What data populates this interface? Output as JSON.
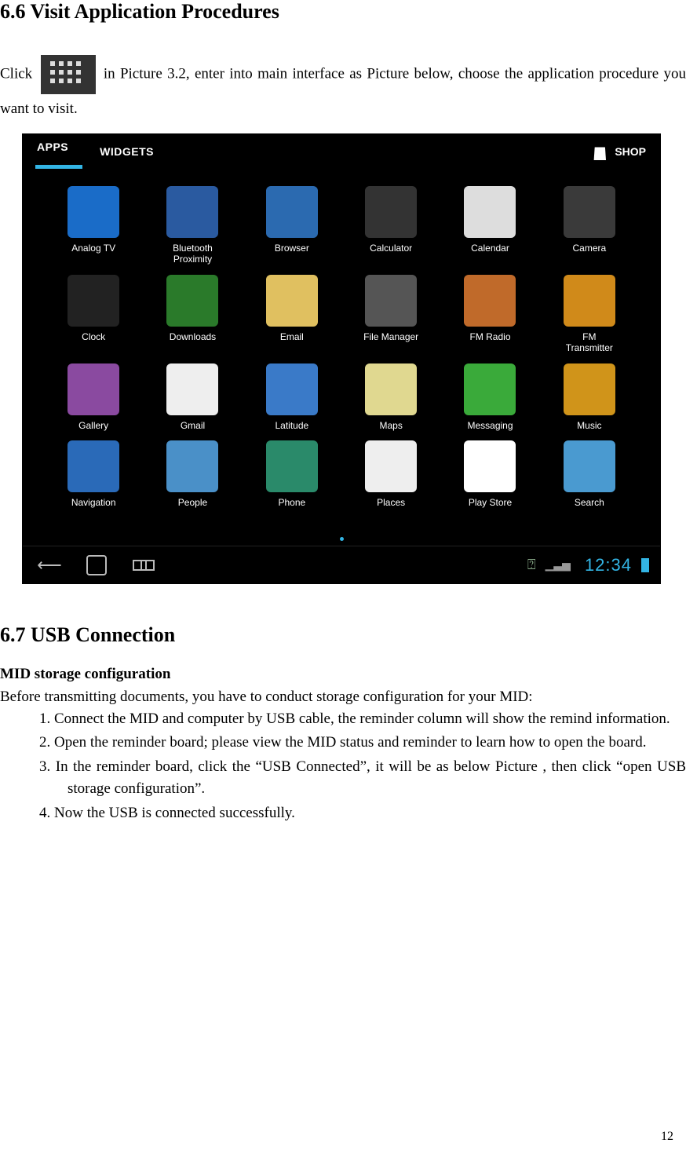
{
  "sections": {
    "s66": {
      "heading": "6.6 Visit Application Procedures",
      "para_a": "Click ",
      "para_b": "in  Picture  3.2,  enter  into  main  interface  as  Picture  below,  choose  the application procedure you want to visit."
    },
    "s67": {
      "heading": "6.7 USB Connection",
      "sub": "MID storage configuration",
      "intro": "Before transmitting documents, you have to conduct storage configuration for your MID:",
      "steps": [
        "1.  Connect the MID and computer by USB cable, the reminder column will show the remind information.",
        "2.   Open the reminder board; please view the MID status and reminder to learn how to open the board.",
        "3.   In  the  reminder  board,  click  the  “USB  Connected”,  it  will  be  as  below  Picture  ,  then click “open USB storage configuration”.",
        "4.   Now the USB is connected successfully."
      ]
    }
  },
  "screenshot": {
    "tabs": {
      "apps": "APPS",
      "widgets": "WIDGETS",
      "shop": "SHOP"
    },
    "apps": [
      {
        "label": "Analog TV",
        "bg": "#1a6cc8"
      },
      {
        "label": "Bluetooth\nProximity",
        "bg": "#2a5aa0"
      },
      {
        "label": "Browser",
        "bg": "#2b6ab0"
      },
      {
        "label": "Calculator",
        "bg": "#333"
      },
      {
        "label": "Calendar",
        "bg": "#ddd"
      },
      {
        "label": "Camera",
        "bg": "#3a3a3a"
      },
      {
        "label": "Clock",
        "bg": "#222"
      },
      {
        "label": "Downloads",
        "bg": "#2a7a2a"
      },
      {
        "label": "Email",
        "bg": "#e0c060"
      },
      {
        "label": "File Manager",
        "bg": "#555"
      },
      {
        "label": "FM Radio",
        "bg": "#c06a2a"
      },
      {
        "label": "FM\nTransmitter",
        "bg": "#d08a1a"
      },
      {
        "label": "Gallery",
        "bg": "#8a4aa0"
      },
      {
        "label": "Gmail",
        "bg": "#eee"
      },
      {
        "label": "Latitude",
        "bg": "#3a7ac8"
      },
      {
        "label": "Maps",
        "bg": "#e0d890"
      },
      {
        "label": "Messaging",
        "bg": "#3aaa3a"
      },
      {
        "label": "Music",
        "bg": "#d0941a"
      },
      {
        "label": "Navigation",
        "bg": "#2a6ab8"
      },
      {
        "label": "People",
        "bg": "#4a90c8"
      },
      {
        "label": "Phone",
        "bg": "#2a8a6a"
      },
      {
        "label": "Places",
        "bg": "#eee"
      },
      {
        "label": "Play Store",
        "bg": "#fff"
      },
      {
        "label": "Search",
        "bg": "#4a9ad0"
      }
    ],
    "clock": "12:34"
  },
  "page_number": "12"
}
